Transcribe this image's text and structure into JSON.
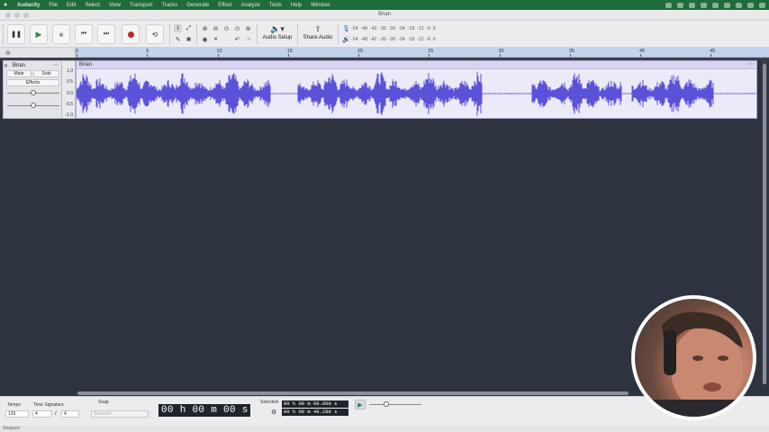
{
  "menubar": {
    "items": [
      "Audacity",
      "File",
      "Edit",
      "Select",
      "View",
      "Transport",
      "Tracks",
      "Generate",
      "Effect",
      "Analyze",
      "Tools",
      "Help",
      "Window"
    ]
  },
  "window": {
    "title": "Brian"
  },
  "toolbar": {
    "pause_icon": "pause-icon",
    "play_icon": "play-icon",
    "stop_icon": "stop-icon",
    "skip_start_icon": "skip-start-icon",
    "skip_end_icon": "skip-end-icon",
    "record_icon": "record-icon",
    "loop_icon": "loop-icon",
    "audio_setup_label": "Audio Setup",
    "share_audio_label": "Share Audio",
    "meter_scale": "-54 -48 -42 -36 -30 -24 -18 -12 -6 0",
    "record_color": "#c0262d",
    "play_color": "#2e8b4f"
  },
  "ruler": {
    "ticks": [
      "0",
      "5",
      "10",
      "15",
      "20",
      "25",
      "30",
      "35",
      "40",
      "45"
    ]
  },
  "track": {
    "name": "Brian",
    "mute_label": "Mute",
    "solo_label": "Solo",
    "effects_label": "Effects",
    "gain_level": 0.5,
    "pan_level": 0.5,
    "scale": [
      "1.0",
      "0.5",
      "0.0",
      "-0.5",
      "-1.0"
    ],
    "clip_name": "Brian",
    "waveform_color": "#5a52d8",
    "duration_seconds": 48.288
  },
  "bottom": {
    "tempo_label": "Tempo",
    "tempo_value": "120",
    "time_signature_label": "Time Signature",
    "time_sig_num": "4",
    "time_sig_sep": "/",
    "time_sig_den": "4",
    "snap_label": "Snap",
    "snap_value": "Seconds",
    "big_time": "00 h 00 m 00 s",
    "selection_label": "Selection",
    "selection_start": "00 h 00 m 00.000 s",
    "selection_end": "00 h 00 m 48.288 s",
    "playback_speed": 0.3
  },
  "status": {
    "text": "Stopped."
  }
}
